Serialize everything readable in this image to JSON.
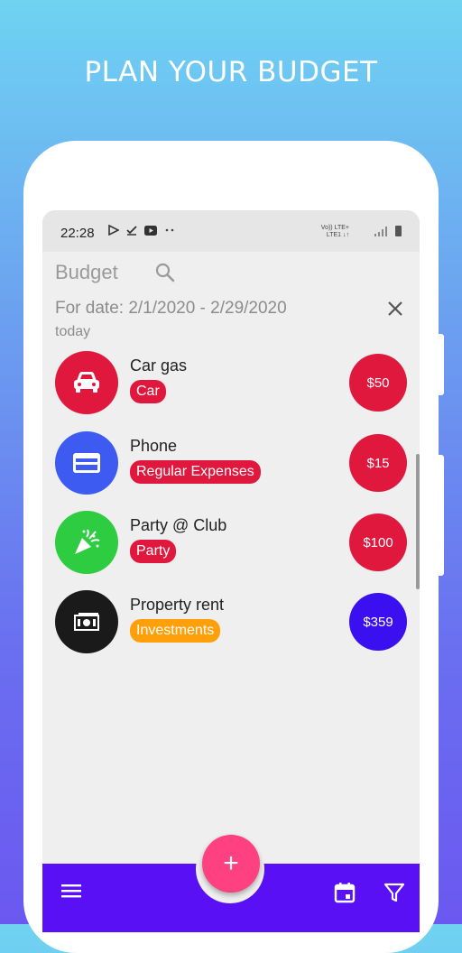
{
  "headline": "PLAN YOUR BUDGET",
  "status": {
    "time": "22:28",
    "network_top": "Vo)) LTE+",
    "network_bottom": "LTE1 ↓↑"
  },
  "app": {
    "title": "Budget",
    "date_filter": "For date: 2/1/2020 - 2/29/2020",
    "today_label": "today"
  },
  "items": [
    {
      "title": "Car gas",
      "tag": "Car",
      "amount": "$50",
      "icon": "car-icon",
      "icon_color": "#e0183d",
      "tag_color": "#e0183d",
      "amount_color": "#e0183d"
    },
    {
      "title": "Phone",
      "tag": "Regular Expenses",
      "amount": "$15",
      "icon": "credit-card-icon",
      "icon_color": "#3d5af1",
      "tag_color": "#e0183d",
      "amount_color": "#e0183d"
    },
    {
      "title": "Party @ Club",
      "tag": "Party",
      "amount": "$100",
      "icon": "party-popper-icon",
      "icon_color": "#2ecc40",
      "tag_color": "#e0183d",
      "amount_color": "#e0183d"
    },
    {
      "title": "Property rent",
      "tag": "Investments",
      "amount": "$359",
      "icon": "money-icon",
      "icon_color": "#1a1a1a",
      "tag_color": "#ff9f0a",
      "amount_color": "#3a10f0"
    }
  ],
  "fab_label": "+",
  "colors": {
    "bottom_bar": "#5a10f5",
    "fab": "#ff4081"
  }
}
